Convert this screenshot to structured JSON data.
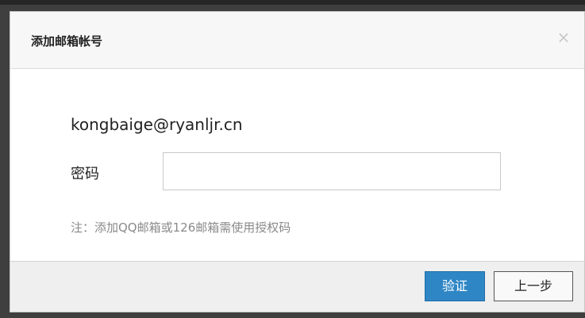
{
  "dialog": {
    "title": "添加邮箱帐号",
    "close_label": "×",
    "email": "kongbaige@ryanljr.cn",
    "password_label": "密码",
    "password_value": "",
    "note": "注：添加QQ邮箱或126邮箱需使用授权码",
    "verify_label": "验证",
    "back_label": "上一步"
  },
  "colors": {
    "primary": "#2f86c5",
    "overlay": "#3f3f3f"
  }
}
